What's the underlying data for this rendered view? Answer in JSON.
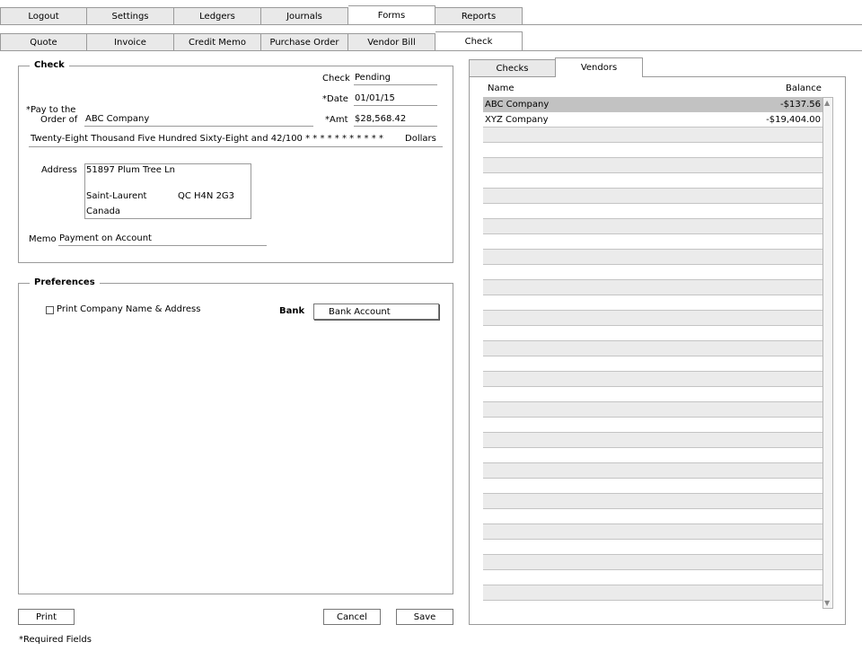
{
  "top_tabs": [
    "Logout",
    "Settings",
    "Ledgers",
    "Journals",
    "Forms",
    "Reports"
  ],
  "top_active": 4,
  "form_tabs": [
    "Quote",
    "Invoice",
    "Credit Memo",
    "Purchase Order",
    "Vendor Bill",
    "Check"
  ],
  "form_active": 5,
  "check": {
    "legend": "Check",
    "check_label": "Check",
    "check_value": "Pending",
    "date_label": "*Date",
    "date_value": "01/01/15",
    "pay_label_1": "*Pay to the",
    "pay_label_2": "Order of",
    "pay_value": "ABC Company",
    "amt_label": "*Amt",
    "amt_value": "$28,568.42",
    "amount_words": "Twenty-Eight Thousand Five Hundred Sixty-Eight and 42/100 *  *  *  *  *  *  *  *  *  *  *",
    "dollars_label": "Dollars",
    "address_label": "Address",
    "address_line1": "51897 Plum Tree Ln",
    "address_city": "Saint-Laurent",
    "address_region": "QC  H4N 2G3",
    "address_country": "Canada",
    "memo_label": "Memo",
    "memo_value": "Payment on Account"
  },
  "preferences": {
    "legend": "Preferences",
    "print_company_label": "Print Company Name & Address",
    "print_company_checked": false,
    "bank_label": "Bank",
    "bank_account_button": "Bank Account"
  },
  "buttons": {
    "print": "Print",
    "cancel": "Cancel",
    "save": "Save"
  },
  "required_note": "*Required Fields",
  "right_panel": {
    "tabs": [
      "Checks",
      "Vendors"
    ],
    "active": 1,
    "col_name": "Name",
    "col_balance": "Balance",
    "rows": [
      {
        "name": "ABC Company",
        "balance": "-$137.56",
        "selected": true
      },
      {
        "name": "XYZ Company",
        "balance": "-$19,404.00",
        "selected": false
      }
    ],
    "total_rows": 33
  }
}
